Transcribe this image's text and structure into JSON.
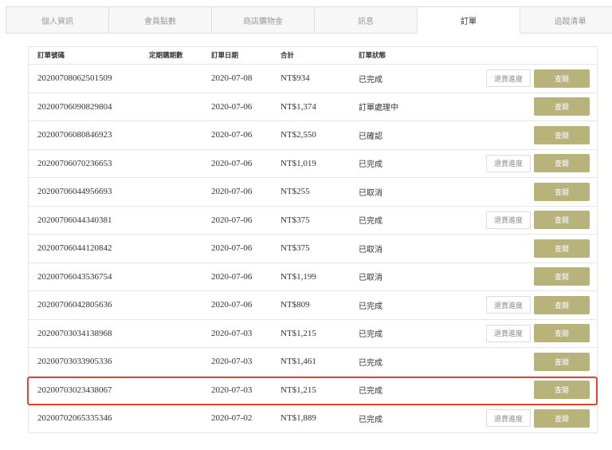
{
  "tabs": [
    {
      "label": "個人資訊",
      "active": false
    },
    {
      "label": "會員點數",
      "active": false
    },
    {
      "label": "商店購物金",
      "active": false
    },
    {
      "label": "訊息",
      "active": false
    },
    {
      "label": "訂單",
      "active": true
    },
    {
      "label": "追蹤清單",
      "active": false
    }
  ],
  "orders": {
    "columns": {
      "order_no": "訂單號碼",
      "term": "定期購期數",
      "date": "訂單日期",
      "total": "合計",
      "status": "訂單狀態"
    },
    "return_label": "退貨進度",
    "view_label": "查閱",
    "rows": [
      {
        "order_no": "20200708062501509",
        "date": "2020-07-08",
        "total": "NT$934",
        "status": "已完成",
        "has_return": true,
        "highlighted": false
      },
      {
        "order_no": "20200706090829804",
        "date": "2020-07-06",
        "total": "NT$1,374",
        "status": "訂單處理中",
        "has_return": false,
        "highlighted": false
      },
      {
        "order_no": "20200706080846923",
        "date": "2020-07-06",
        "total": "NT$2,550",
        "status": "已確認",
        "has_return": false,
        "highlighted": false
      },
      {
        "order_no": "20200706070236653",
        "date": "2020-07-06",
        "total": "NT$1,019",
        "status": "已完成",
        "has_return": true,
        "highlighted": false
      },
      {
        "order_no": "20200706044956693",
        "date": "2020-07-06",
        "total": "NT$255",
        "status": "已取消",
        "has_return": false,
        "highlighted": false
      },
      {
        "order_no": "20200706044340381",
        "date": "2020-07-06",
        "total": "NT$375",
        "status": "已完成",
        "has_return": true,
        "highlighted": false
      },
      {
        "order_no": "20200706044120842",
        "date": "2020-07-06",
        "total": "NT$375",
        "status": "已取消",
        "has_return": false,
        "highlighted": false
      },
      {
        "order_no": "20200706043536754",
        "date": "2020-07-06",
        "total": "NT$1,199",
        "status": "已取消",
        "has_return": false,
        "highlighted": false
      },
      {
        "order_no": "20200706042805636",
        "date": "2020-07-06",
        "total": "NT$809",
        "status": "已完成",
        "has_return": true,
        "highlighted": false
      },
      {
        "order_no": "20200703034138968",
        "date": "2020-07-03",
        "total": "NT$1,215",
        "status": "已完成",
        "has_return": true,
        "highlighted": false
      },
      {
        "order_no": "20200703033905336",
        "date": "2020-07-03",
        "total": "NT$1,461",
        "status": "已完成",
        "has_return": false,
        "highlighted": false
      },
      {
        "order_no": "20200703023438067",
        "date": "2020-07-03",
        "total": "NT$1,215",
        "status": "已完成",
        "has_return": false,
        "highlighted": true
      },
      {
        "order_no": "20200702065335346",
        "date": "2020-07-02",
        "total": "NT$1,889",
        "status": "已完成",
        "has_return": true,
        "highlighted": false
      }
    ]
  },
  "colors": {
    "view_button": "#b7b37a",
    "highlight_border": "#e4442d"
  }
}
